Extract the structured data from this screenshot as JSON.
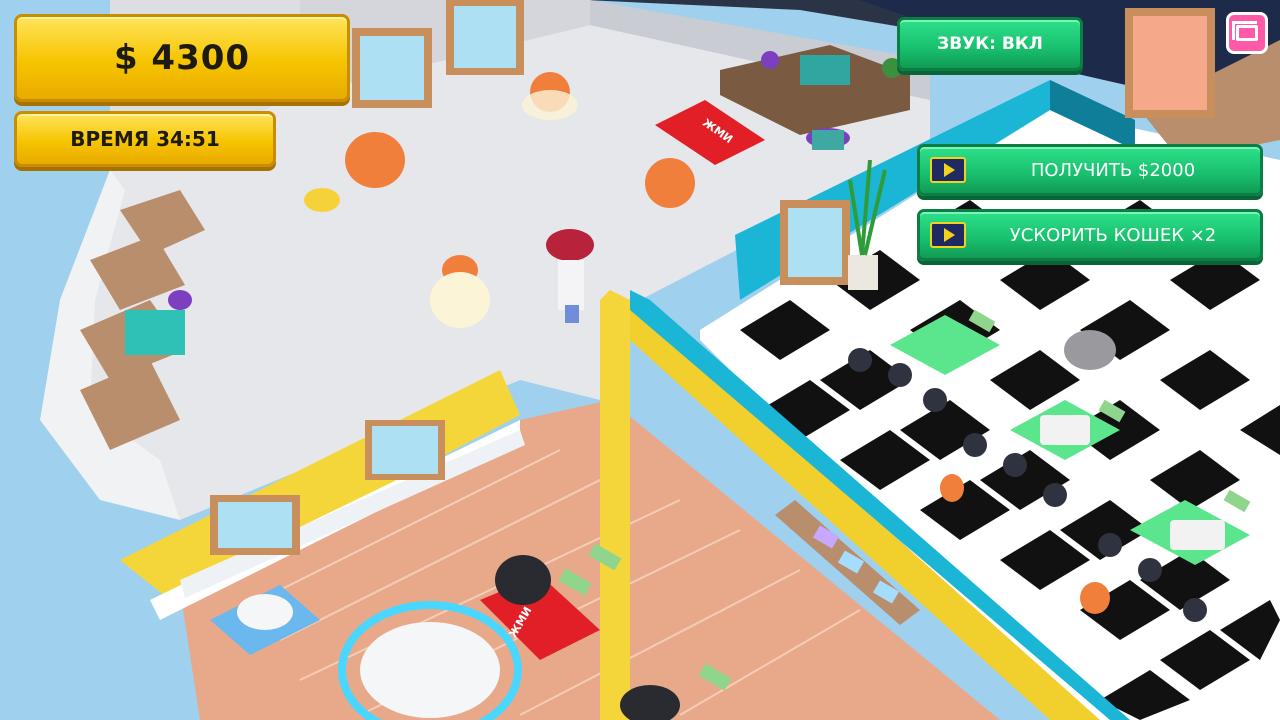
{
  "hud": {
    "money": "$ 4300",
    "timer": "ВРЕМЯ 34:51",
    "sound_button": "ЗВУК: ВКЛ",
    "reward_button": "ПОЛУЧИТЬ $2000",
    "speed_button": "УСКОРИТЬ КОШЕК ×2"
  },
  "world": {
    "mat_label_top": "ЖМИ",
    "mat_label_bottom": "ЖМИ"
  },
  "icons": {
    "video_ad": "video-play-icon",
    "menu": "window-switch-icon"
  },
  "colors": {
    "hud_yellow": "#f6c400",
    "hud_green": "#18bf6c",
    "ad_icon_bg": "#1f2a63",
    "menu_pink": "#ff5aa8"
  }
}
